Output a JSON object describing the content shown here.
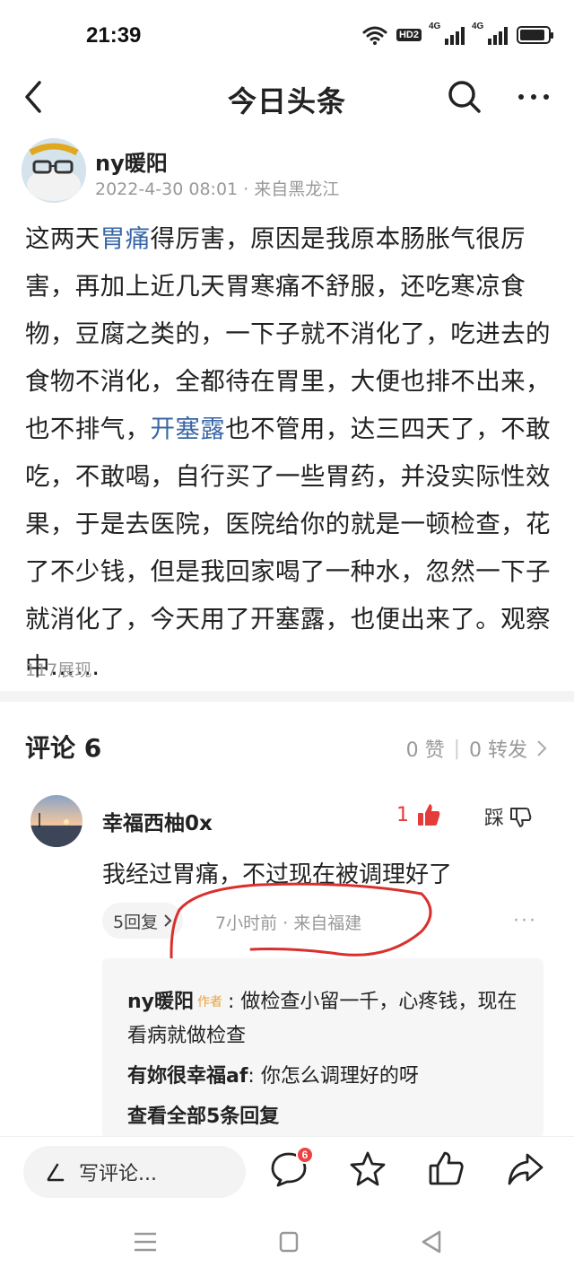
{
  "status_bar": {
    "time": "21:39",
    "hd_label": "HD2",
    "signal1_label": "4G",
    "signal2_label": "4G",
    "battery_level": 0.9
  },
  "nav": {
    "title": "今日头条",
    "back_icon": "chevron-left-icon",
    "search_icon": "search-icon",
    "more_icon": "more-horizontal-icon"
  },
  "author": {
    "name": "ny暖阳",
    "meta": "2022-4-30 08:01 · 来自黑龙江"
  },
  "post": {
    "p1": "这两天",
    "tag1": "胃痛",
    "p2": "得厉害，原因是我原本肠胀气很厉害，再加上近几天胃寒痛不舒服，还吃寒凉食物，豆腐之类的，一下子就不消化了，吃进去的食物不消化，全都待在胃里，大便也排不出来，也不排气，",
    "tag2": "开塞露",
    "p3": "也不管用，达三四天了，不敢吃，不敢喝，自行买了一些胃药，并没实际性效果，于是去医院，医院给你的就是一顿检查，花了不少钱，但是我回家喝了一种水，忽然一下子就消化了，今天用了开塞露，也便出来了。观察中……",
    "views": "117展现"
  },
  "comments": {
    "title": "评论 6",
    "likes": "0 赞",
    "shares": "0 转发",
    "items": [
      {
        "name": "幸福西柚0x",
        "like_count": "1",
        "dislike_label": "踩",
        "text": "我经过胃痛，不过现在被调理好了",
        "reply_count_label": "5回复",
        "meta": "7小时前 · 来自福建",
        "replies": [
          {
            "name": "ny暖阳",
            "badge": "作者",
            "text": ": 做检查小留一千，心疼钱，现在看病就做检查"
          },
          {
            "name": "有妳很幸福af",
            "text": ": 你怎么调理好的呀"
          }
        ],
        "view_all": "查看全部5条回复"
      }
    ]
  },
  "bottom_bar": {
    "write_placeholder": "写评论...",
    "comment_badge": "6",
    "icons": [
      "pen-icon",
      "comment-icon",
      "star-icon",
      "thumbs-up-icon",
      "share-icon"
    ]
  },
  "colors": {
    "tag_blue": "#3a67a7",
    "like_red": "#e43b3b",
    "annotation_red": "#d9302e",
    "badge_orange": "#e6a23c"
  }
}
